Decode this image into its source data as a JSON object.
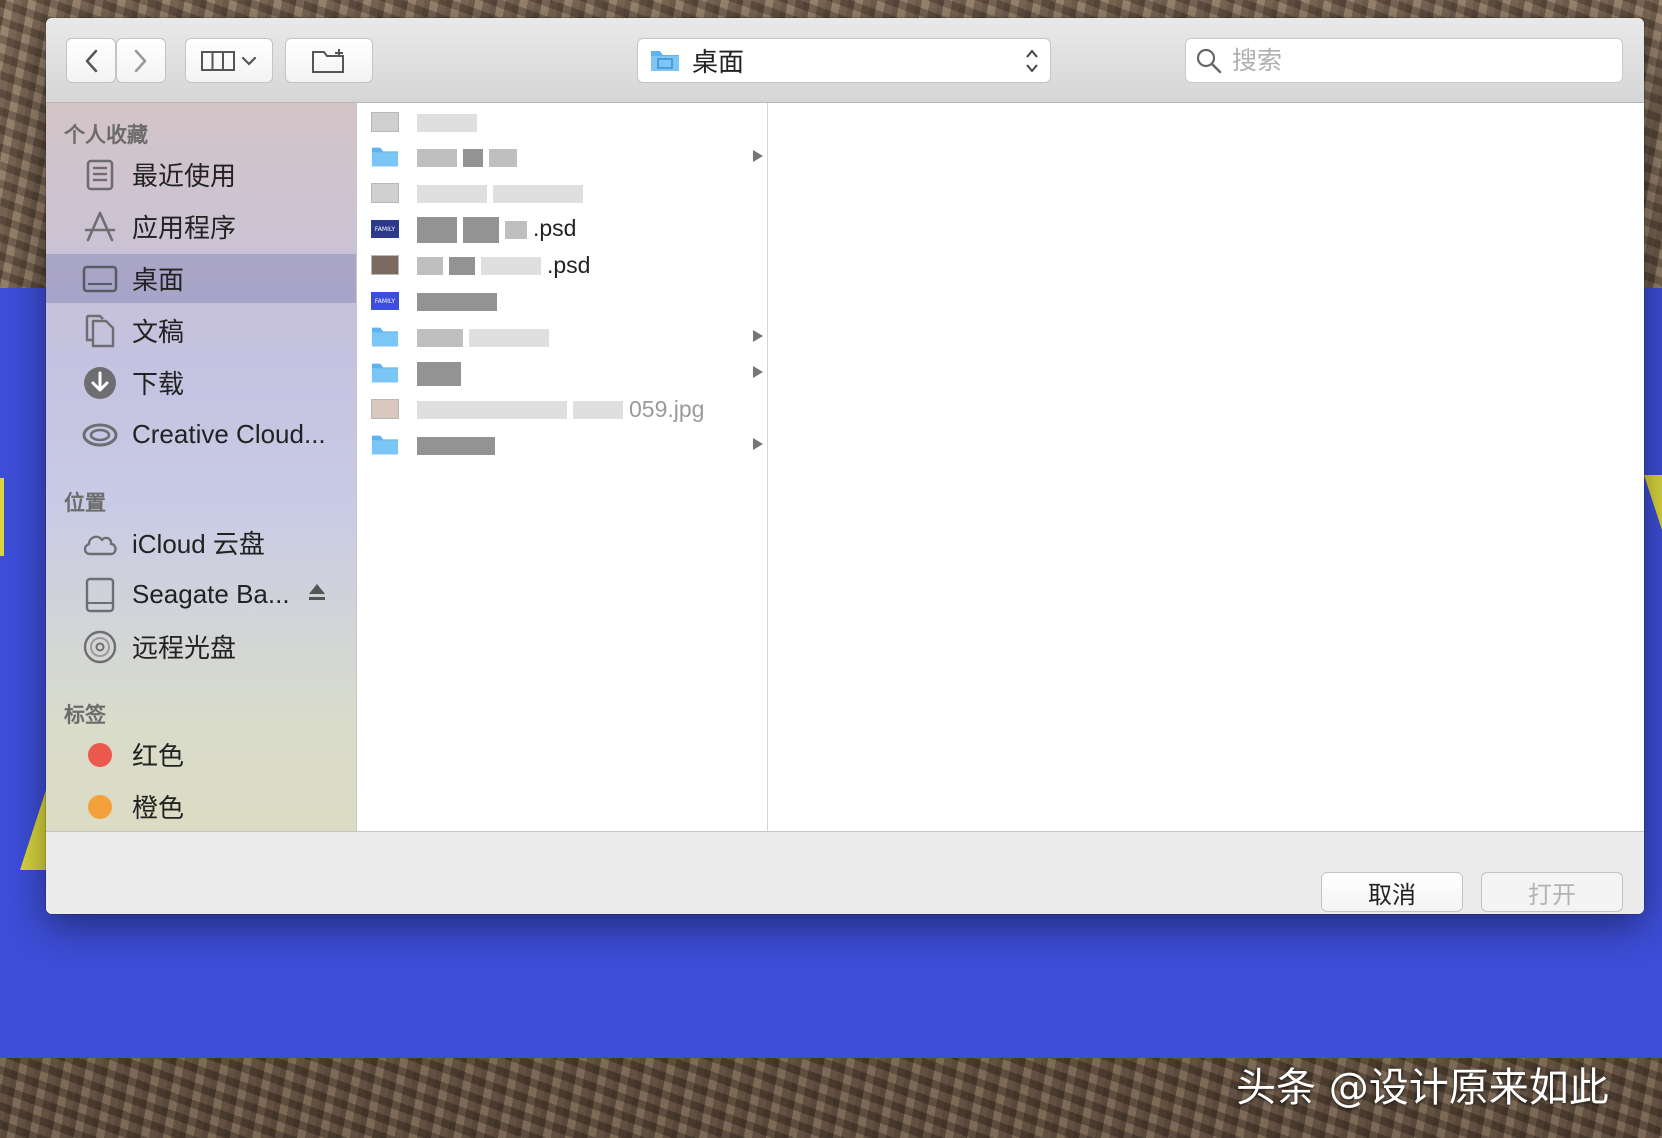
{
  "toolbar": {
    "back_icon": "chevron-left-icon",
    "forward_icon": "chevron-right-icon",
    "view_icon": "columns-view-icon",
    "new_folder_icon": "new-folder-icon",
    "location": "桌面",
    "search_placeholder": "搜索"
  },
  "sidebar": {
    "favorites_header": "个人收藏",
    "favorites": [
      {
        "label": "最近使用",
        "icon": "recents-icon"
      },
      {
        "label": "应用程序",
        "icon": "applications-icon"
      },
      {
        "label": "桌面",
        "icon": "desktop-icon",
        "selected": true
      },
      {
        "label": "文稿",
        "icon": "documents-icon"
      },
      {
        "label": "下载",
        "icon": "downloads-icon"
      },
      {
        "label": "Creative Cloud...",
        "icon": "creative-cloud-icon"
      }
    ],
    "locations_header": "位置",
    "locations": [
      {
        "label": "iCloud 云盘",
        "icon": "icloud-icon"
      },
      {
        "label": "Seagate Ba...",
        "icon": "external-drive-icon"
      },
      {
        "label": "远程光盘",
        "icon": "optical-disc-icon"
      }
    ],
    "tags_header": "标签",
    "tags": [
      {
        "label": "红色",
        "color": "#ec5a4e"
      },
      {
        "label": "橙色",
        "color": "#f2a13b"
      }
    ]
  },
  "files": [
    {
      "kind": "image",
      "name_suffix": ""
    },
    {
      "kind": "folder",
      "name_suffix": ""
    },
    {
      "kind": "image",
      "name_suffix": ""
    },
    {
      "kind": "psd",
      "name_suffix": ".psd"
    },
    {
      "kind": "image",
      "name_suffix": ".psd"
    },
    {
      "kind": "family",
      "name_suffix": ""
    },
    {
      "kind": "folder",
      "name_suffix": ""
    },
    {
      "kind": "folder",
      "name_suffix": ""
    },
    {
      "kind": "image",
      "name_suffix": "059.jpg"
    },
    {
      "kind": "folder",
      "name_suffix": ""
    }
  ],
  "buttons": {
    "cancel": "取消",
    "open": "打开"
  },
  "watermark": "头条 @设计原来如此",
  "colors": {
    "accent_blue": "#3d4ed8",
    "folder_blue": "#5fb4ef",
    "tag_red": "#ec5a4e",
    "tag_orange": "#f2a13b"
  }
}
